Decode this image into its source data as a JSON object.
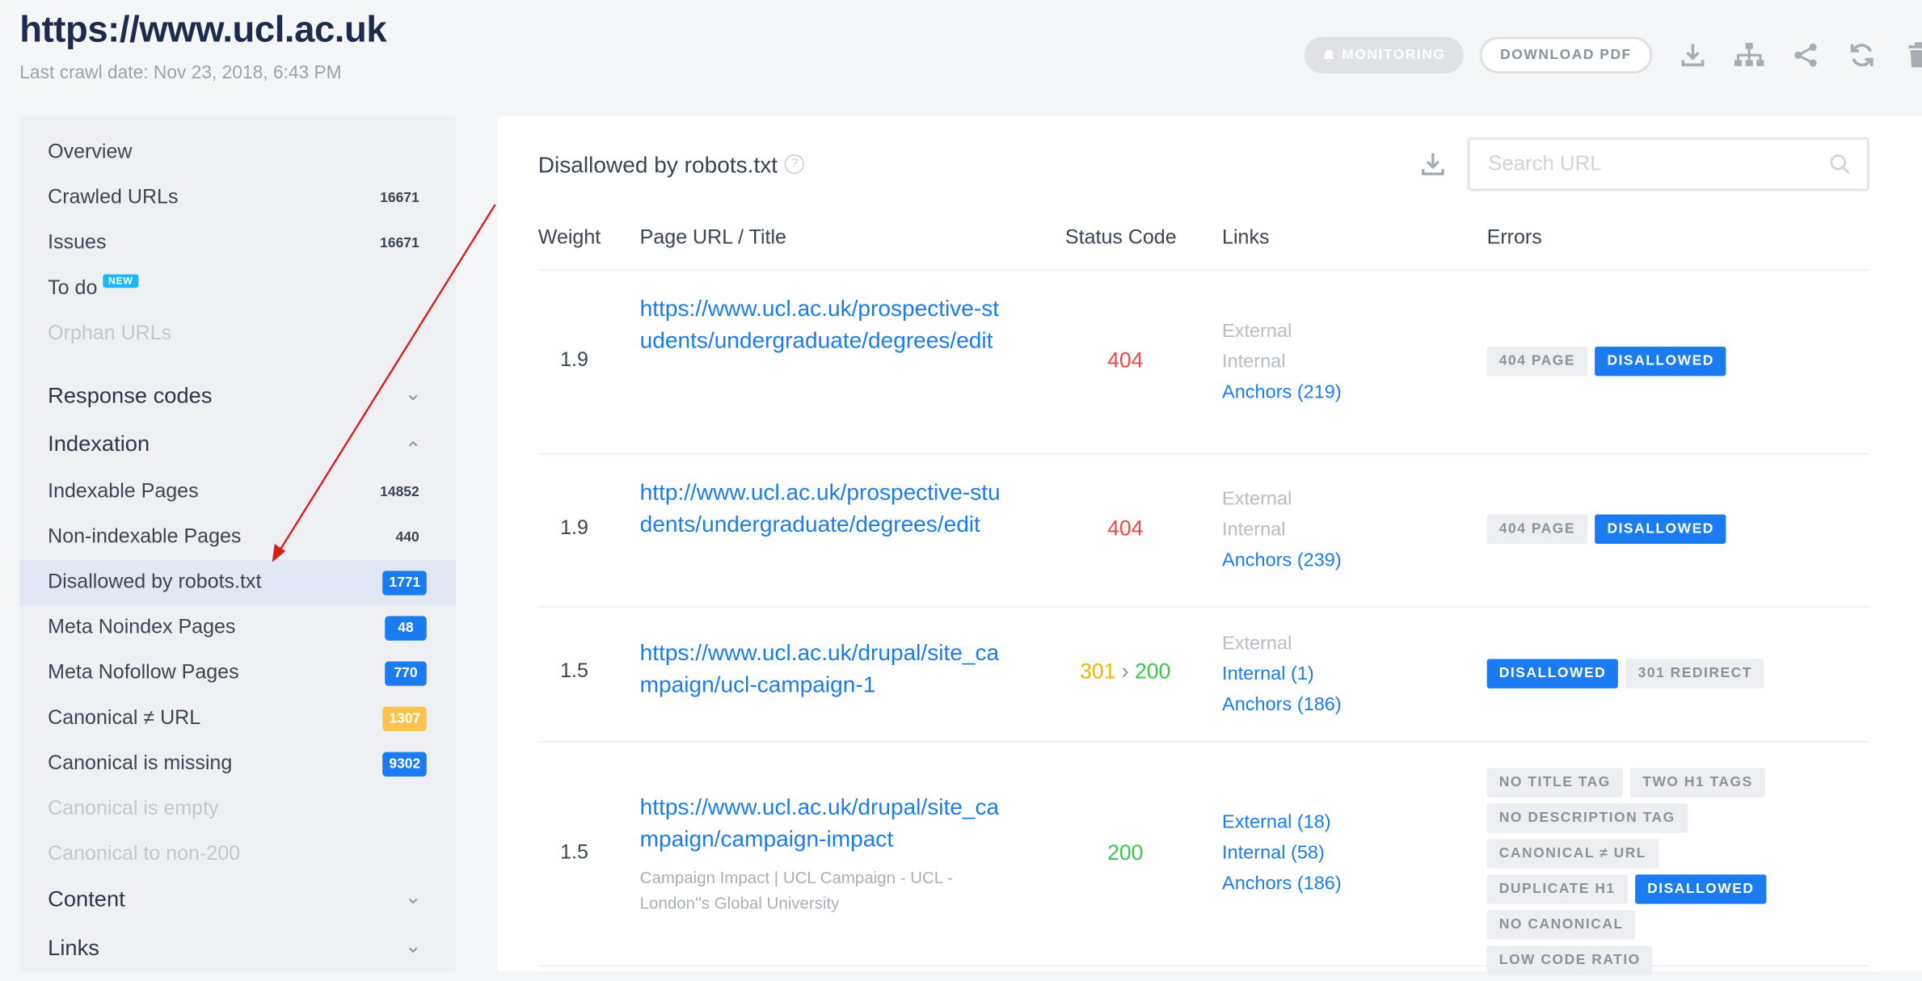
{
  "header": {
    "site": "https://www.ucl.ac.uk",
    "crawl_date": "Last crawl date: Nov 23, 2018, 6:43 PM",
    "monitoring_label": "MONITORING",
    "download_pdf_label": "DOWNLOAD PDF",
    "icons": [
      "download-icon",
      "sitemap-icon",
      "share-icon",
      "refresh-icon",
      "trash-icon"
    ]
  },
  "sidebar": {
    "overview": "Overview",
    "crawled_urls": {
      "label": "Crawled URLs",
      "count": "16671"
    },
    "issues": {
      "label": "Issues",
      "count": "16671"
    },
    "todo": {
      "label": "To do",
      "tag": "NEW"
    },
    "orphan": "Orphan URLs",
    "response_codes": "Response codes",
    "indexation": "Indexation",
    "indexable": {
      "label": "Indexable Pages",
      "count": "14852"
    },
    "non_indexable": {
      "label": "Non-indexable Pages",
      "count": "440"
    },
    "disallowed": {
      "label": "Disallowed by robots.txt",
      "count": "1771"
    },
    "meta_noindex": {
      "label": "Meta Noindex Pages",
      "count": "48"
    },
    "meta_nofollow": {
      "label": "Meta Nofollow Pages",
      "count": "770"
    },
    "canonical_ne": {
      "label": "Canonical ≠ URL",
      "count": "1307"
    },
    "canonical_missing": {
      "label": "Canonical is missing",
      "count": "9302"
    },
    "canonical_empty": "Canonical is empty",
    "canonical_non200": "Canonical to non-200",
    "content": "Content",
    "links": "Links"
  },
  "main": {
    "title": "Disallowed by robots.txt",
    "search_placeholder": "Search URL",
    "columns": [
      "Weight",
      "Page URL / Title",
      "Status Code",
      "Links",
      "Errors"
    ],
    "rows": [
      {
        "weight": "1.9",
        "url": "https://www.ucl.ac.uk/prospective-students/undergraduate/degrees/edit",
        "status_a": "404",
        "links": {
          "external": "External",
          "internal": "Internal",
          "anchors": "Anchors (219)"
        },
        "tags": [
          "404 PAGE",
          "DISALLOWED"
        ]
      },
      {
        "weight": "1.9",
        "url": "http://www.ucl.ac.uk/prospective-students/undergraduate/degrees/edit",
        "status_a": "404",
        "links": {
          "external": "External",
          "internal": "Internal",
          "anchors": "Anchors (239)"
        },
        "tags": [
          "404 PAGE",
          "DISALLOWED"
        ]
      },
      {
        "weight": "1.5",
        "url": "https://www.ucl.ac.uk/drupal/site_campaign/ucl-campaign-1",
        "status_a": "301",
        "status_sep": "›",
        "status_b": "200",
        "links": {
          "external": "External",
          "internal": "Internal (1)",
          "anchors": "Anchors (186)"
        },
        "tags": [
          "DISALLOWED",
          "301 REDIRECT"
        ]
      },
      {
        "weight": "1.5",
        "url": "https://www.ucl.ac.uk/drupal/site_campaign/campaign-impact",
        "title": "Campaign Impact | UCL Campaign - UCL - London''s Global University",
        "status_a": "200",
        "links": {
          "external": "External (18)",
          "internal": "Internal (58)",
          "anchors": "Anchors (186)"
        },
        "tags": [
          "NO TITLE TAG",
          "TWO H1 TAGS",
          "NO DESCRIPTION TAG",
          "CANONICAL ≠ URL",
          "DUPLICATE H1",
          "DISALLOWED",
          "NO CANONICAL",
          "LOW CODE RATIO"
        ]
      }
    ]
  },
  "colors": {
    "accent": "#1a7cf0",
    "error": "#f04747",
    "redirect": "#f5b400",
    "ok": "#3cc44c",
    "badge_warning": "#fbc44e",
    "annotation_arrow": "#d8201c"
  }
}
